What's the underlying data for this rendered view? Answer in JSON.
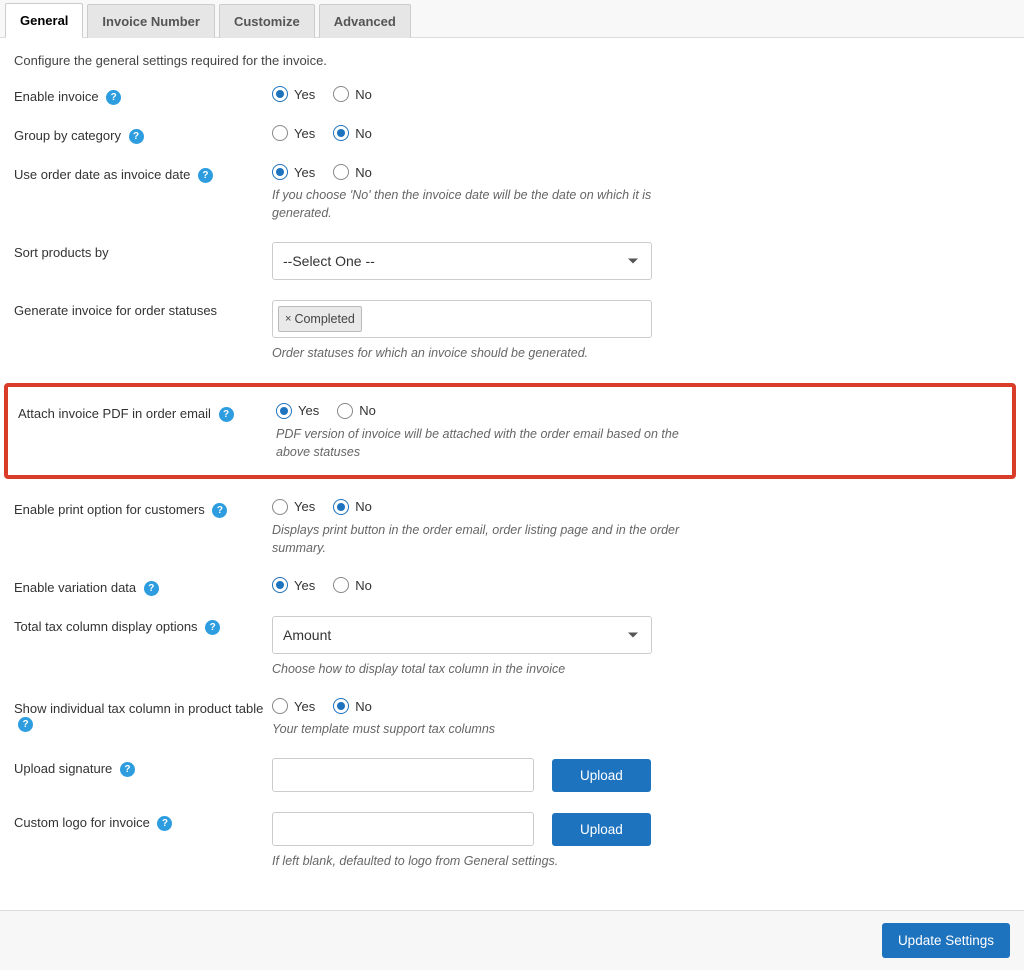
{
  "tabs": {
    "general": "General",
    "invoice_number": "Invoice Number",
    "customize": "Customize",
    "advanced": "Advanced"
  },
  "intro": "Configure the general settings required for the invoice.",
  "radio_yes": "Yes",
  "radio_no": "No",
  "fields": {
    "enable_invoice": {
      "label": "Enable invoice"
    },
    "group_by_category": {
      "label": "Group by category"
    },
    "use_order_date": {
      "label": "Use order date as invoice date",
      "hint": "If you choose 'No' then the invoice date will be the date on which it is generated."
    },
    "sort_products": {
      "label": "Sort products by",
      "placeholder": "--Select One --"
    },
    "generate_for_statuses": {
      "label": "Generate invoice for order statuses",
      "tag": "Completed",
      "hint": "Order statuses for which an invoice should be generated."
    },
    "attach_pdf": {
      "label": "Attach invoice PDF in order email",
      "hint": "PDF version of invoice will be attached with the order email based on the above statuses"
    },
    "enable_print": {
      "label": "Enable print option for customers",
      "hint": "Displays print button in the order email, order listing page and in the order summary."
    },
    "enable_variation": {
      "label": "Enable variation data"
    },
    "tax_display": {
      "label": "Total tax column display options",
      "value": "Amount",
      "hint": "Choose how to display total tax column in the invoice"
    },
    "individual_tax": {
      "label": "Show individual tax column in product table",
      "hint": "Your template must support tax columns"
    },
    "upload_signature": {
      "label": "Upload signature",
      "button": "Upload"
    },
    "custom_logo": {
      "label": "Custom logo for invoice",
      "button": "Upload",
      "hint": "If left blank, defaulted to logo from General settings."
    }
  },
  "footer": {
    "update": "Update Settings"
  }
}
